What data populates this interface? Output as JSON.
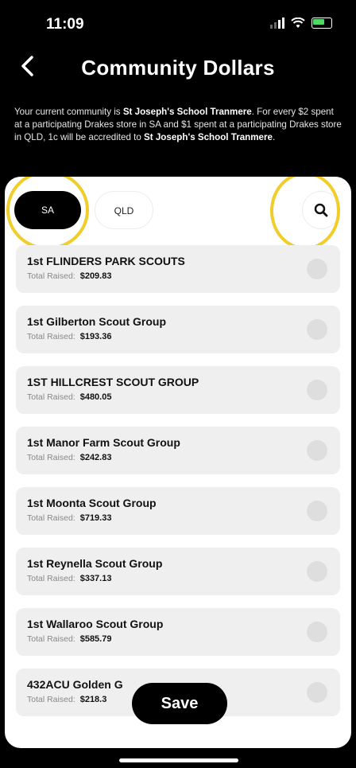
{
  "status_bar": {
    "time": "11:09"
  },
  "header": {
    "back_icon": "chevron-left-icon",
    "title": "Community Dollars"
  },
  "intro": {
    "prefix": "Your current community is ",
    "community": "St Joseph's School Tranmere",
    "middle": ". For every $2 spent at a participating Drakes store in SA and $1 spent at a participating Drakes store in QLD, 1c will be accredited to ",
    "community_repeat": "St Joseph's School Tranmere",
    "suffix": "."
  },
  "tabs": [
    {
      "label": "SA",
      "selected": true
    },
    {
      "label": "QLD",
      "selected": false
    }
  ],
  "search_icon": "search-icon",
  "highlight_color": "#f0cd28",
  "total_raised_label": "Total Raised:",
  "groups": [
    {
      "name": "1st FLINDERS PARK SCOUTS",
      "amount": "$209.83"
    },
    {
      "name": "1st Gilberton Scout Group",
      "amount": "$193.36"
    },
    {
      "name": "1ST HILLCREST SCOUT GROUP",
      "amount": "$480.05"
    },
    {
      "name": "1st Manor Farm Scout Group",
      "amount": "$242.83"
    },
    {
      "name": "1st Moonta Scout Group",
      "amount": "$719.33"
    },
    {
      "name": "1st Reynella Scout Group",
      "amount": "$337.13"
    },
    {
      "name": "1st Wallaroo Scout Group",
      "amount": "$585.79"
    },
    {
      "name": "432ACU Golden G",
      "amount": "$218.3"
    }
  ],
  "save_label": "Save"
}
